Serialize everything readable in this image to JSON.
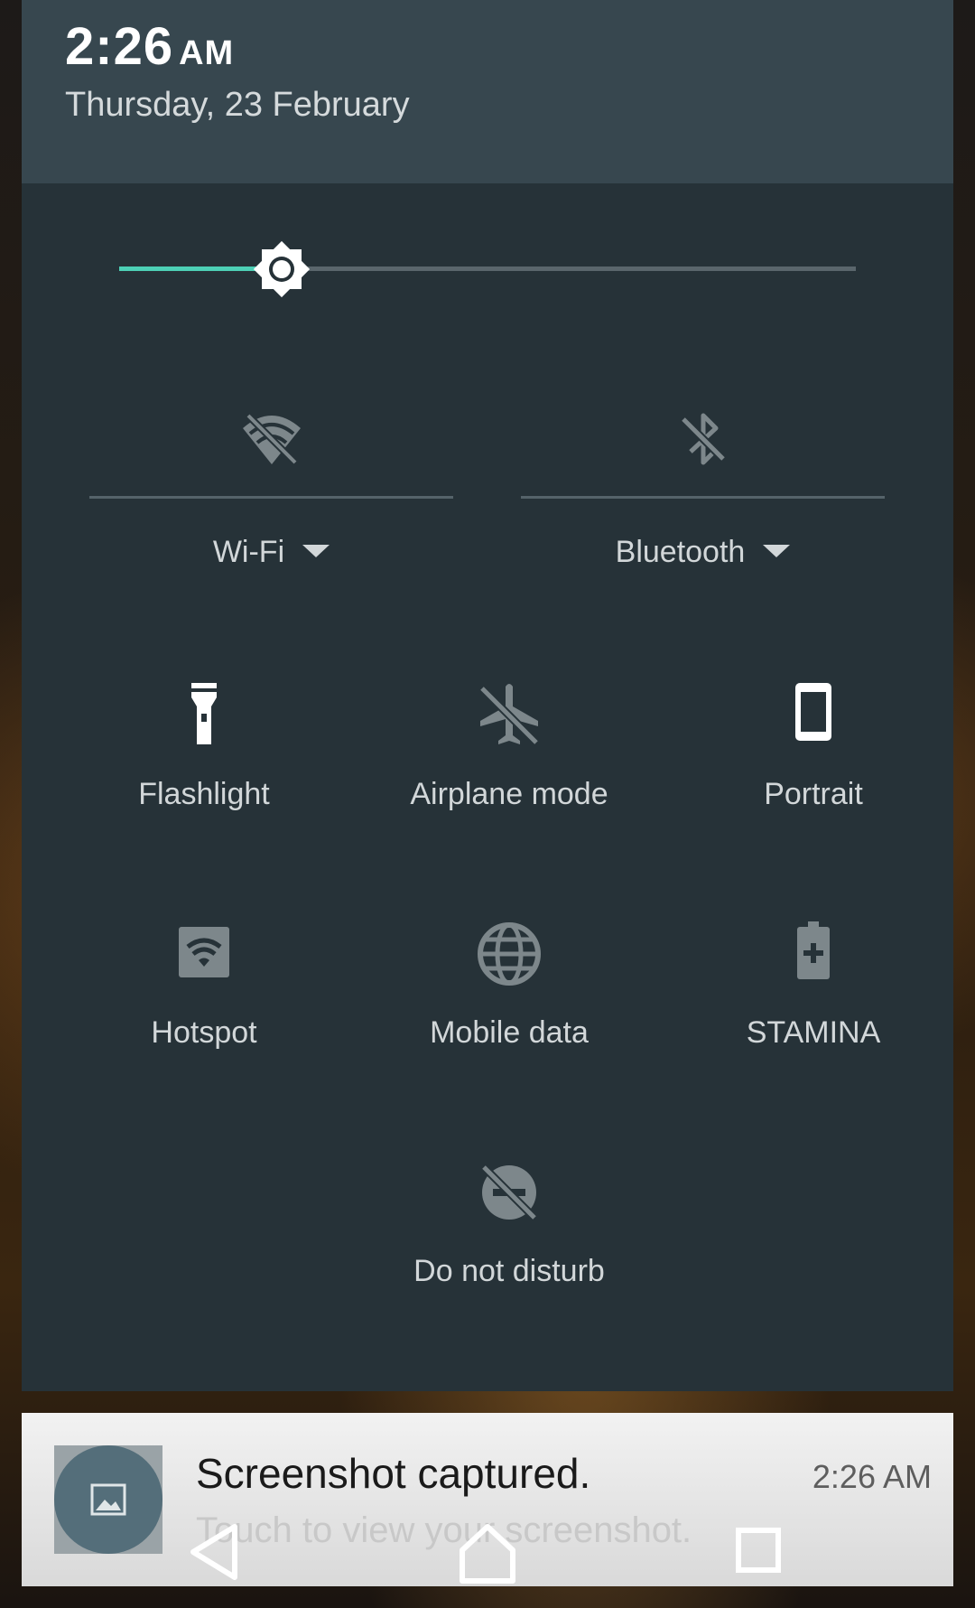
{
  "header": {
    "time": "2:26",
    "ampm": "AM",
    "date": "Thursday, 23 February"
  },
  "brightness": {
    "level": 0.22,
    "accent_color": "#4dd0b6"
  },
  "big_tiles": [
    {
      "label": "Wi-Fi",
      "icon": "wifi-off-icon",
      "state": "off"
    },
    {
      "label": "Bluetooth",
      "icon": "bluetooth-off-icon",
      "state": "off"
    }
  ],
  "tiles": [
    {
      "label": "Flashlight",
      "icon": "flashlight-icon",
      "state": "on"
    },
    {
      "label": "Airplane mode",
      "icon": "airplane-off-icon",
      "state": "off"
    },
    {
      "label": "Portrait",
      "icon": "portrait-phone-icon",
      "state": "on"
    },
    {
      "label": "Hotspot",
      "icon": "hotspot-icon",
      "state": "off"
    },
    {
      "label": "Mobile data",
      "icon": "globe-icon",
      "state": "off"
    },
    {
      "label": "STAMINA",
      "icon": "battery-plus-icon",
      "state": "off"
    },
    {
      "label": "Do not disturb",
      "icon": "do-not-disturb-off-icon",
      "state": "off"
    }
  ],
  "notification": {
    "title": "Screenshot captured.",
    "subtitle": "Touch to view your screenshot.",
    "time": "2:26 AM",
    "icon": "image-icon"
  },
  "navbar": [
    "back-icon",
    "home-icon",
    "recents-icon"
  ],
  "colors": {
    "panel": "#263238",
    "header": "#37474f",
    "icon_on": "#ffffff",
    "icon_off": "#7d878b"
  }
}
